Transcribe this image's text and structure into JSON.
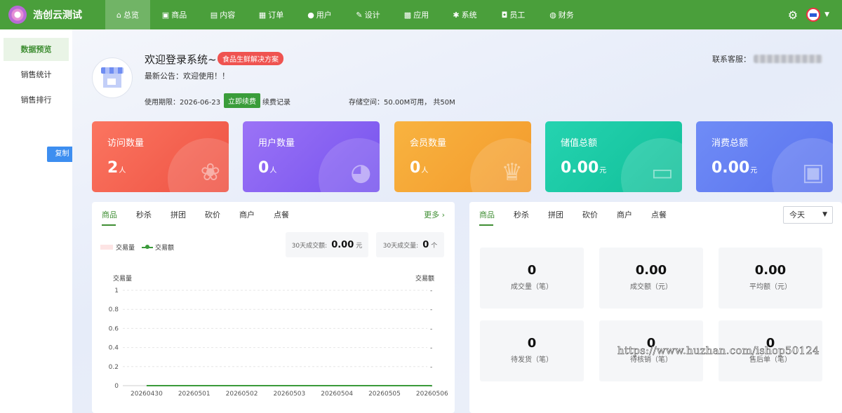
{
  "brand": {
    "name": "浩创云测试"
  },
  "nav": [
    {
      "label": "总览",
      "icon": "home-icon",
      "glyph": "⌂",
      "active": true
    },
    {
      "label": "商品",
      "icon": "shop-icon",
      "glyph": "▣"
    },
    {
      "label": "内容",
      "icon": "document-icon",
      "glyph": "▤"
    },
    {
      "label": "订单",
      "icon": "order-icon",
      "glyph": "▦"
    },
    {
      "label": "用户",
      "icon": "user-icon",
      "glyph": "●"
    },
    {
      "label": "设计",
      "icon": "brush-icon",
      "glyph": "✎"
    },
    {
      "label": "应用",
      "icon": "grid-icon",
      "glyph": "▩"
    },
    {
      "label": "系统",
      "icon": "gear-icon",
      "glyph": "✱"
    },
    {
      "label": "员工",
      "icon": "lock-icon",
      "glyph": "◘"
    },
    {
      "label": "财务",
      "icon": "money-bag-icon",
      "glyph": "◍"
    }
  ],
  "sidebar": {
    "items": [
      {
        "label": "数据预览",
        "active": true
      },
      {
        "label": "销售统计"
      },
      {
        "label": "销售排行"
      }
    ],
    "copy_label": "复制"
  },
  "welcome": {
    "title": "欢迎登录系统~",
    "badge": "食品生鲜解决方案",
    "notice": "最新公告：欢迎使用！！",
    "expire": "使用期限：2026-06-23",
    "renew": "立即续费",
    "record": "续费记录",
    "storage": "存储空间：50.00M可用， 共50M",
    "service_label": "联系客服："
  },
  "cards": [
    {
      "label": "访问数量",
      "value": "2",
      "unit": "人",
      "icon": "paw-icon",
      "glyph": "❀"
    },
    {
      "label": "用户数量",
      "value": "0",
      "unit": "人",
      "icon": "users-icon",
      "glyph": "◕"
    },
    {
      "label": "会员数量",
      "value": "0",
      "unit": "人",
      "icon": "crown-icon",
      "glyph": "♛"
    },
    {
      "label": "储值总额",
      "value": "0.00",
      "unit": "元",
      "icon": "card-icon",
      "glyph": "▭"
    },
    {
      "label": "消费总额",
      "value": "0.00",
      "unit": "元",
      "icon": "wallet-icon",
      "glyph": "▣"
    }
  ],
  "left_panel": {
    "tabs": [
      "商品",
      "秒杀",
      "拼团",
      "砍价",
      "商户",
      "点餐"
    ],
    "more": "更多 ›",
    "legend_bar": "交易量",
    "legend_line": "交易额",
    "sum1_label": "30天成交额:",
    "sum1_value": "0.00",
    "sum1_unit": "元",
    "sum2_label": "30天成交量:",
    "sum2_value": "0",
    "sum2_unit": "个"
  },
  "chart_data": {
    "type": "line",
    "x": [
      "20260430",
      "20260501",
      "20260502",
      "20260503",
      "20260504",
      "20260505",
      "20260506"
    ],
    "series": [
      {
        "name": "交易量",
        "kind": "bar",
        "values": [
          0,
          0,
          0,
          0,
          0,
          0,
          0
        ],
        "color": "#fde4e4"
      },
      {
        "name": "交易额",
        "kind": "line",
        "values": [
          0,
          0,
          0,
          0,
          0,
          0,
          0
        ],
        "color": "#3a9a3a"
      }
    ],
    "ylabel_left": "交易量",
    "ylabel_right": "交易额",
    "yticks_left": [
      "0",
      "0.2",
      "0.4",
      "0.6",
      "0.8",
      "1"
    ],
    "yticks_right": [
      "-",
      "-",
      "-",
      "-",
      "-",
      "-"
    ],
    "ylim": [
      0,
      1
    ],
    "grid": true,
    "legend": "top-left"
  },
  "right_panel": {
    "tabs": [
      "商品",
      "秒杀",
      "拼团",
      "砍价",
      "商户",
      "点餐"
    ],
    "select": "今天",
    "kpis": [
      {
        "value": "0",
        "label": "成交量（笔）"
      },
      {
        "value": "0.00",
        "label": "成交额（元）"
      },
      {
        "value": "0.00",
        "label": "平均额（元）"
      },
      {
        "value": "0",
        "label": "待发货（笔）"
      },
      {
        "value": "0",
        "label": "待核销（笔）"
      },
      {
        "value": "0",
        "label": "售后单（笔）"
      }
    ]
  },
  "watermark": "https://www.huzhan.com/ishop50124"
}
